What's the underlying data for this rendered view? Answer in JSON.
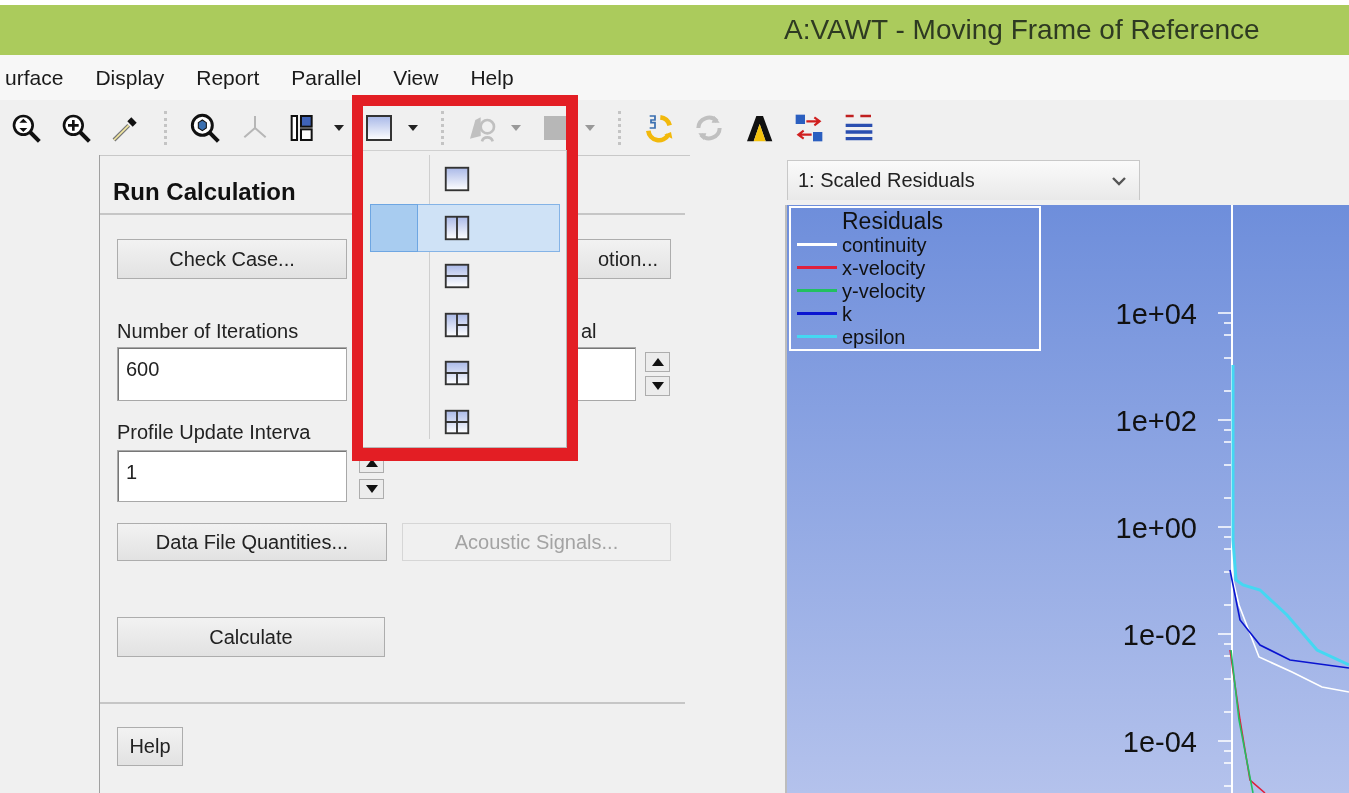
{
  "window": {
    "title": "A:VAWT - Moving Frame of Reference"
  },
  "menu": [
    "urface",
    "Display",
    "Report",
    "Parallel",
    "View",
    "Help"
  ],
  "toolbar": [
    {
      "kind": "zoom-fit",
      "disabled": false,
      "dropdown": false
    },
    {
      "kind": "zoom-in",
      "disabled": false,
      "dropdown": false
    },
    {
      "kind": "probe",
      "disabled": false,
      "dropdown": false
    },
    {
      "kind": "separator"
    },
    {
      "kind": "zoom-box",
      "disabled": false,
      "dropdown": false
    },
    {
      "kind": "axes",
      "disabled": true,
      "dropdown": false
    },
    {
      "kind": "layout",
      "disabled": false,
      "dropdown": true
    },
    {
      "kind": "pane",
      "disabled": false,
      "dropdown": true
    },
    {
      "kind": "separator"
    },
    {
      "kind": "view",
      "disabled": true,
      "dropdown": true
    },
    {
      "kind": "square",
      "disabled": true,
      "dropdown": true
    },
    {
      "kind": "separator"
    },
    {
      "kind": "refresh-s",
      "disabled": false,
      "dropdown": false
    },
    {
      "kind": "refresh",
      "disabled": true,
      "dropdown": false
    },
    {
      "kind": "logo",
      "disabled": false,
      "dropdown": false
    },
    {
      "kind": "swap",
      "disabled": false,
      "dropdown": false
    },
    {
      "kind": "moe",
      "disabled": false,
      "dropdown": false
    }
  ],
  "layout_menu": {
    "items": [
      {
        "kind": "single",
        "selected": false
      },
      {
        "kind": "two-columns",
        "selected": true
      },
      {
        "kind": "two-rows",
        "selected": false
      },
      {
        "kind": "left-plus-two",
        "selected": false
      },
      {
        "kind": "top-plus-two",
        "selected": false
      },
      {
        "kind": "four",
        "selected": false
      }
    ]
  },
  "panel": {
    "title": "Run Calculation",
    "check_case": {
      "label": "Check Case...",
      "disabled": false
    },
    "mesh_motion": {
      "label": "otion...",
      "disabled": false
    },
    "iterations": {
      "label": "Number of Iterations",
      "value": "600"
    },
    "reporting": {
      "label": "al"
    },
    "profile": {
      "label": "Profile Update Interva",
      "value": "1"
    },
    "data_file": {
      "label": "Data File Quantities...",
      "disabled": false
    },
    "acoustic": {
      "label": "Acoustic Signals...",
      "disabled": true
    },
    "calculate": {
      "label": "Calculate",
      "disabled": false
    },
    "help": {
      "label": "Help",
      "disabled": false
    }
  },
  "graphics": {
    "window_select": "1: Scaled Residuals",
    "plot": {
      "legend_title": "Residuals",
      "legend": [
        {
          "label": "continuity",
          "color": "#ffffff"
        },
        {
          "label": "x-velocity",
          "color": "#e0203c"
        },
        {
          "label": "y-velocity",
          "color": "#22c060"
        },
        {
          "label": "k",
          "color": "#0a14d0"
        },
        {
          "label": "epsilon",
          "color": "#44d8f2"
        }
      ],
      "y_tick_labels": [
        "1e+04",
        "1e+02",
        "1e+00",
        "1e-02",
        "1e-04"
      ]
    }
  }
}
